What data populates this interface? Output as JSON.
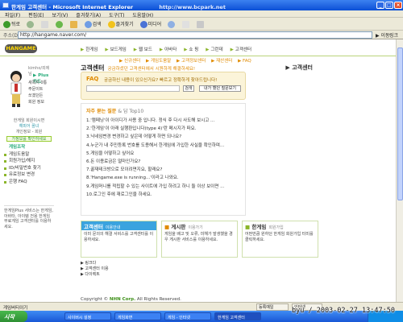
{
  "window": {
    "title": "한게임 고객센터 - Microsoft Internet Explorer",
    "watermark": "http://www.bcpark.net"
  },
  "menu": [
    "파일(F)",
    "편집(E)",
    "보기(V)",
    "즐겨찾기(A)",
    "도구(T)",
    "도움말(H)"
  ],
  "toolbar": {
    "back": "뒤로",
    "search": "검색",
    "favorites": "즐겨찾기",
    "media": "미디어"
  },
  "address": {
    "label": "주소(D)",
    "url": "http://hangame.naver.com/",
    "go": "이동",
    "links": "링크"
  },
  "site": {
    "logo": "HANGAME",
    "gnb": [
      "한게임",
      "보드게임",
      "웹 보드",
      "아바타",
      "쇼 핑",
      "그런데",
      "고객센터"
    ],
    "subnav": [
      "▶ 신규센터",
      "▶ 게임도움말",
      "▶ 고객정보센터",
      "▶ 재산센터",
      "▶ FAQ"
    ]
  },
  "left": {
    "userinfo": "kimho/외에 님",
    "plus": "▶ Plus 카드",
    "menu": [
      "새쪽지 0통",
      "주문이트",
      "쏘겠던든",
      "회원 정보"
    ],
    "green": {
      "line1": "한게임 회원이시면",
      "line2": "해피어 꿈녀",
      "line3": "개인정보 - 회원",
      "btn": "가정보를 확인하세요"
    },
    "leftmenu_head": "게임조작",
    "leftmenu": [
      "게임도움말",
      "회원가입/해지",
      "ID/비밀번호 찾기",
      "유료정보 변경",
      "은행 FAQ"
    ],
    "bottom": "한게임Plus 서비스는 한게임, 아바타, 아이템 전용 한게임 무료게임 고객센터를 이용하세요."
  },
  "main": {
    "headline": "고객센터",
    "headline_sub": "궁금하셨던 고객센터에서 시원하게 해결하세요!",
    "crumb": "▶ 고객센터",
    "faq": {
      "label": "FAQ",
      "desc": "궁금하신 내용이 있으신가요? 빠르고 정확하게 찾아드립니다!",
      "search": "검색",
      "qna": "내가 했던 질문보기"
    },
    "top10_title": "자주 묻는 질문",
    "top10_suffix": "& 답 Top10",
    "top10": [
      "1.'캠페닝'이 아이디가 사용 중 입니다. 정식 후 다시 사도해 보시고 ...",
      "2.'한게임'이 아래 실행환입니다(type 4)'란 메시지가 떠요.",
      "3.닉네임변경 변경하고 싶은데 어떻게 하면 되나요?",
      "4.누군가 내 주민등록 번호를 도용해서 한게임에 가입한 사실을 확인하며...",
      "5.게임을 어떻하고 싶어요",
      "6.돈 이용료금은 얼마인가요?",
      "7.꿀재테크방으로 모이려면지요, 할래요?",
      "8.'Hangame.exe is running...'이라고 나와요.",
      "9.게임머니를 적립할 수 있는 사이트에 가입 하려고 하니 둘 이상 보이면 ...",
      "10.로그인 후에 재로그인을 하세요."
    ],
    "cards": [
      {
        "title": "고객센터",
        "mini": "이용안내",
        "body": "이미 문의의 해결 서비스를 고객센터를 이용하세요."
      },
      {
        "title": "게시판",
        "mini": "이용가기",
        "body": "게임을 배고 및 오류, 미해가 발생했을 경우 게시판 서비스를 이용하세요."
      },
      {
        "title": "한게임",
        "mini": "회원가입",
        "body": "어떤만큼 원하던 한게임 회원가입 터미를 클릭하세요."
      }
    ],
    "links": [
      "▶ 링크다",
      "▶ 고객센터 이용",
      "▶ 다이렉트"
    ],
    "copyright_pre": "Copyright ©",
    "copyright_brand": "NHN Corp.",
    "copyright_post": "All Rights Reserved."
  },
  "status": {
    "left": "게임버티이기",
    "mid": "등록예일",
    "right1": "인터넷"
  },
  "taskbar": {
    "start": "시작",
    "items": [
      "사이버시 설정",
      "게임화면",
      "게임 - 인터넷",
      "한게임 고객센터"
    ],
    "clock": "byu / 2003-02-27 13:47:50"
  },
  "colors": {
    "accent": "#e08a00",
    "green": "#8bb52a",
    "blue": "#3aa3df"
  }
}
